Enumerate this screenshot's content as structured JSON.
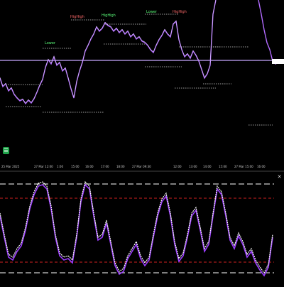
{
  "chart": {
    "colors": {
      "background": "#000000",
      "price_line": "#b26bff",
      "price_line_light": "#e6d6ff",
      "horizontal_line": "#c8a8ff",
      "label_high": "#ff6a6a",
      "label_low": "#5cff7a",
      "stoch_main": "#ffffff",
      "stoch_signal": "#9b3cff",
      "level_red": "#d02020",
      "level_white": "#ffffff"
    },
    "labels": [
      {
        "text": "HigHigh",
        "color_key": "label_high"
      },
      {
        "text": "HigHigh",
        "color_key": "label_low"
      },
      {
        "text": "Lower",
        "color_key": "label_low"
      },
      {
        "text": "HigHigh",
        "color_key": "label_high"
      },
      {
        "text": "Lower",
        "color_key": "label_low"
      }
    ],
    "x_ticks": [
      "25 Mar 2025",
      "27 Mar 12:00",
      "1:00",
      "15:00",
      "16:00",
      "17:00",
      "18:00",
      "27 Mar 09:30",
      "12:00",
      "13:00",
      "14:00",
      "15:00",
      "27 Mar 15:00",
      "16:00"
    ],
    "price_tag": "",
    "icons": {
      "indicator_button": "layers-icon",
      "close_button": "close-icon"
    }
  },
  "oscillator": {
    "levels_white": [
      "80",
      "20"
    ],
    "levels_red": [
      "70",
      "30"
    ]
  }
}
